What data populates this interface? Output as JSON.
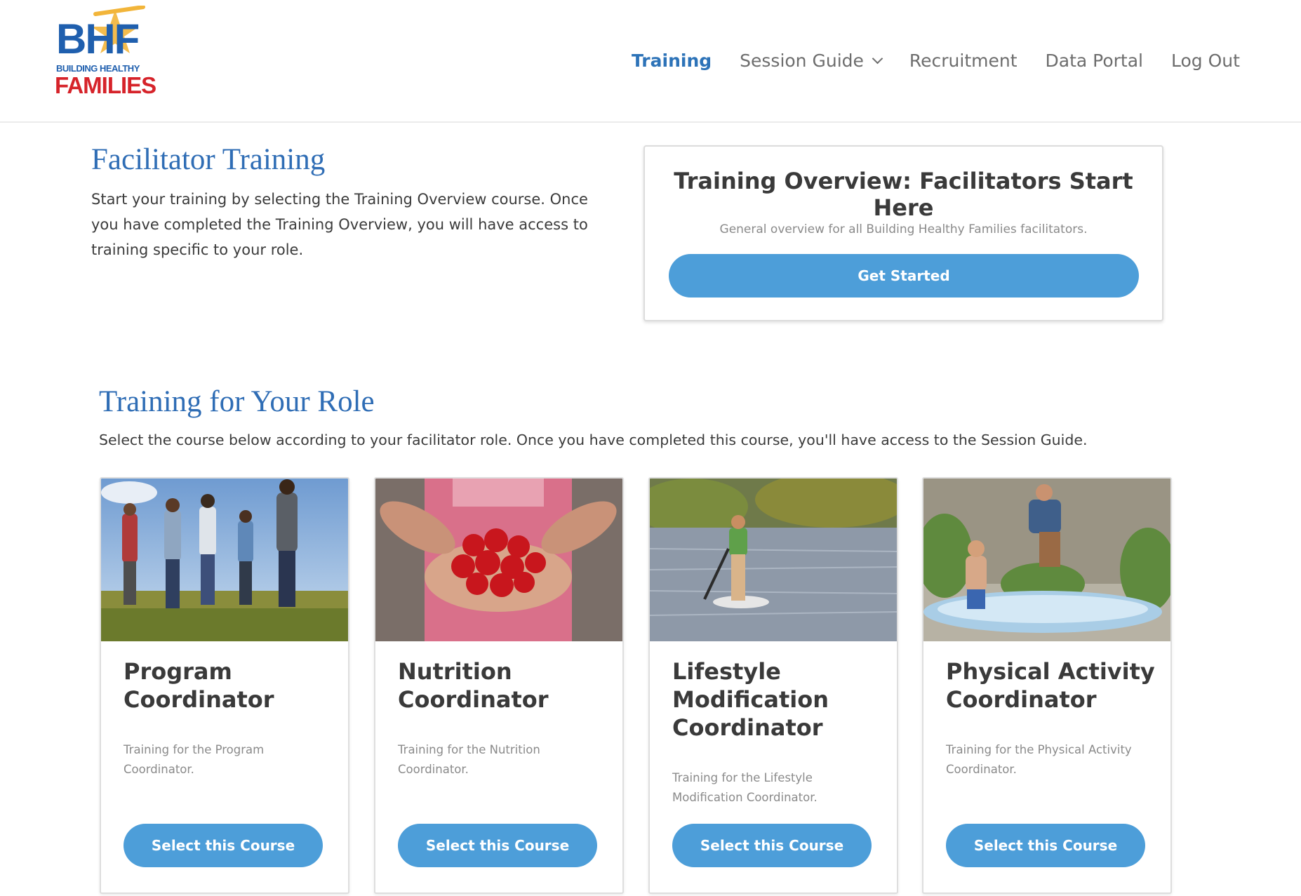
{
  "logo": {
    "mark": "BHF",
    "sub": "BUILDING HEALTHY",
    "word": "FAMILIES"
  },
  "nav": [
    {
      "label": "Training",
      "active": true
    },
    {
      "label": "Session Guide",
      "dropdown": true
    },
    {
      "label": "Recruitment"
    },
    {
      "label": "Data Portal"
    },
    {
      "label": "Log Out"
    }
  ],
  "facilitator": {
    "title": "Facilitator Training",
    "text": "Start your training by selecting the Training Overview course. Once you have completed the Training Overview, you will have access to training specific to your role."
  },
  "overview": {
    "title": "Training Overview: Facilitators Start Here",
    "desc": "General overview for all Building Healthy Families facilitators.",
    "button": "Get Started"
  },
  "role": {
    "title": "Training for Your Role",
    "text": "Select the course below according to your facilitator role. Once you have completed this course, you'll have access to the Session Guide."
  },
  "courses": [
    {
      "title": "Program Coordinator",
      "desc": "Training for the Program Coordinator.",
      "button": "Select this Course",
      "image": "people-running-in-field"
    },
    {
      "title": "Nutrition Coordinator",
      "desc": "Training for the Nutrition Coordinator.",
      "button": "Select this Course",
      "image": "hands-holding-strawberries"
    },
    {
      "title": "Lifestyle Modification Coordinator",
      "desc": "Training for the Lifestyle Modification Coordinator.",
      "button": "Select this Course",
      "image": "paddleboarder-on-river"
    },
    {
      "title": "Physical Activity Coordinator",
      "desc": "Training for the Physical Activity Coordinator.",
      "button": "Select this Course",
      "image": "kids-jumping-in-pool"
    }
  ],
  "colors": {
    "brand_blue": "#2d73b8",
    "button": "#4d9ed9",
    "logo_red": "#d6232a"
  }
}
